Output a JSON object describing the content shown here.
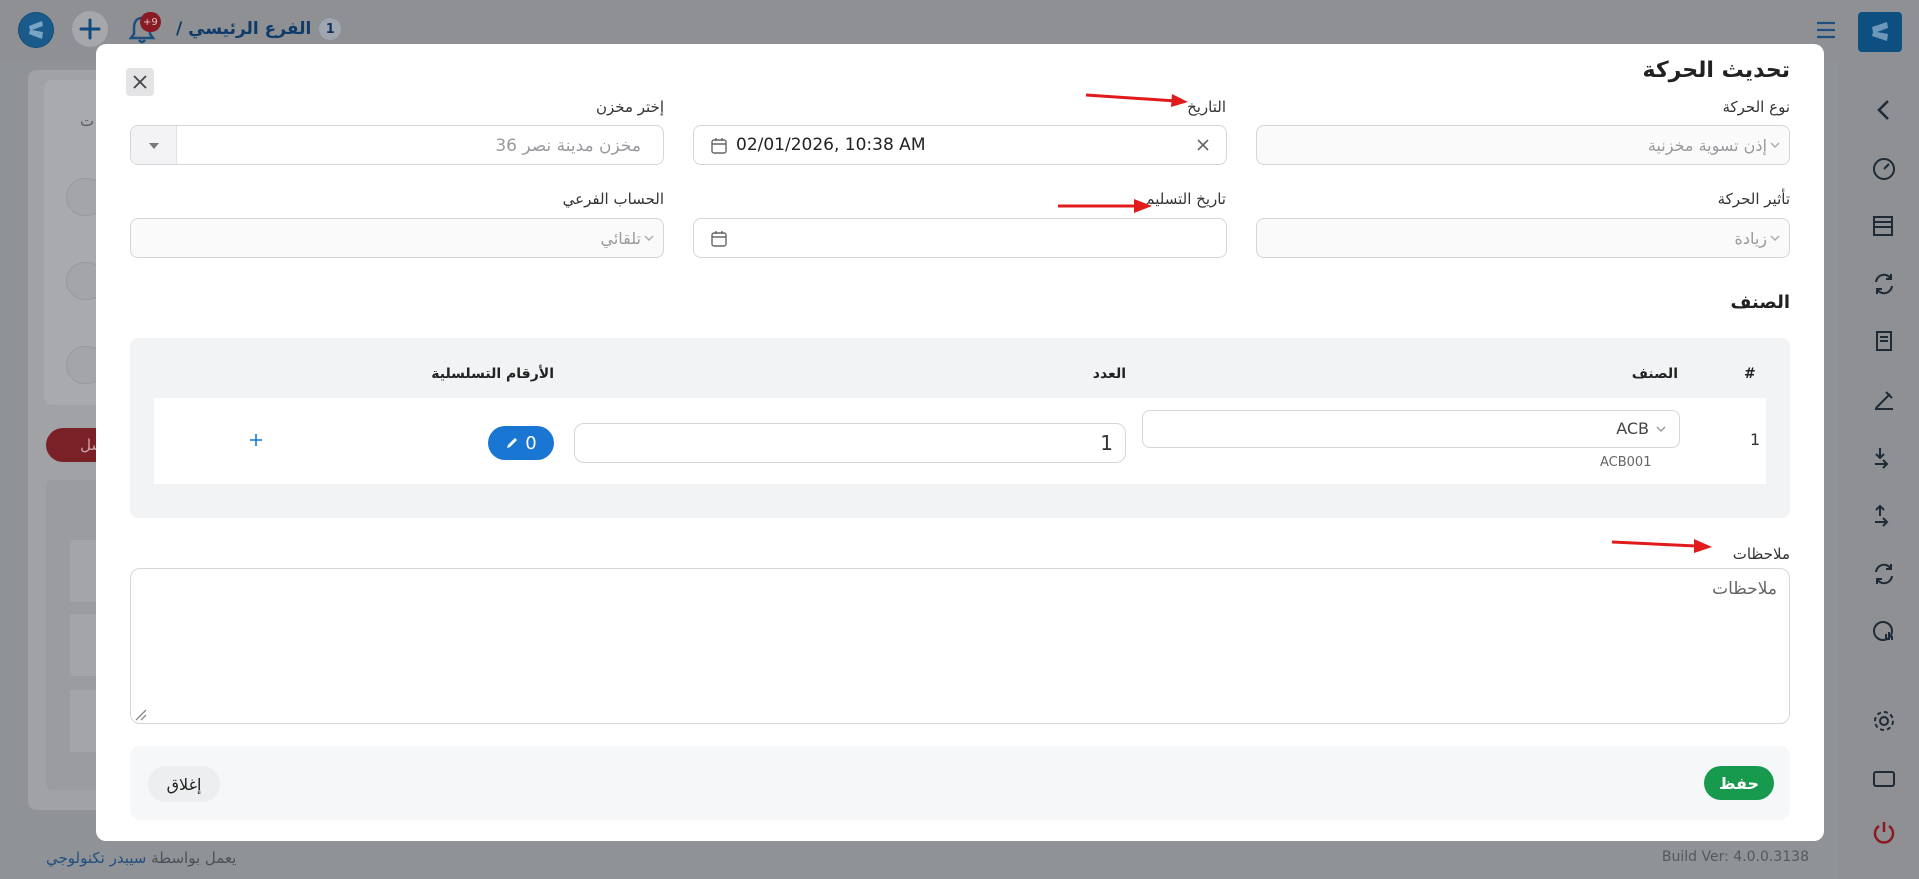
{
  "colors": {
    "primary": "#1976d2",
    "save": "#17994e",
    "annotation_arrow": "#e11b1b",
    "brand": "#0c4f80"
  },
  "topbar": {
    "branch_name": "الفرع الرئيسي /",
    "branch_number": "1",
    "notifications_badge": "+9",
    "icons": [
      "app-logo-icon",
      "plus-icon",
      "bell-icon",
      "menu-icon",
      "brand-logo-icon"
    ]
  },
  "background": {
    "partial_text": "ت",
    "red_button_partial": "سل"
  },
  "footer": {
    "powered_prefix": "يعمل بواسطة",
    "powered_brand": "سيبدر تكنولوجي",
    "build": "Build Ver: 4.0.0.3138"
  },
  "modal": {
    "title": "تحديث الحركة",
    "movement_type": {
      "label": "نوع الحركة",
      "value": "إذن تسوية مخزنية"
    },
    "date": {
      "label": "التاريخ",
      "value": "02/01/2026, 10:38 AM"
    },
    "warehouse": {
      "label": "إختر مخزن",
      "value": "مخزن مدينة نصر 36"
    },
    "movement_effect": {
      "label": "تأثير الحركة",
      "value": "زيادة"
    },
    "delivery_date": {
      "label": "تاريخ التسليم",
      "value": ""
    },
    "sub_account": {
      "label": "الحساب الفرعي",
      "value": "تلقائي"
    },
    "items_section_title": "الصنف",
    "table": {
      "headers": {
        "index": "#",
        "item": "الصنف",
        "quantity": "العدد",
        "serials": "الأرقام التسلسلية"
      },
      "rows": [
        {
          "index": "1",
          "item": "ACB",
          "code": "ACB001",
          "quantity": "1",
          "serial_count": "0"
        }
      ]
    },
    "notes": {
      "label": "ملاحظات",
      "placeholder": "ملاحظات"
    },
    "save_label": "حفظ",
    "close_label": "إغلاق"
  }
}
